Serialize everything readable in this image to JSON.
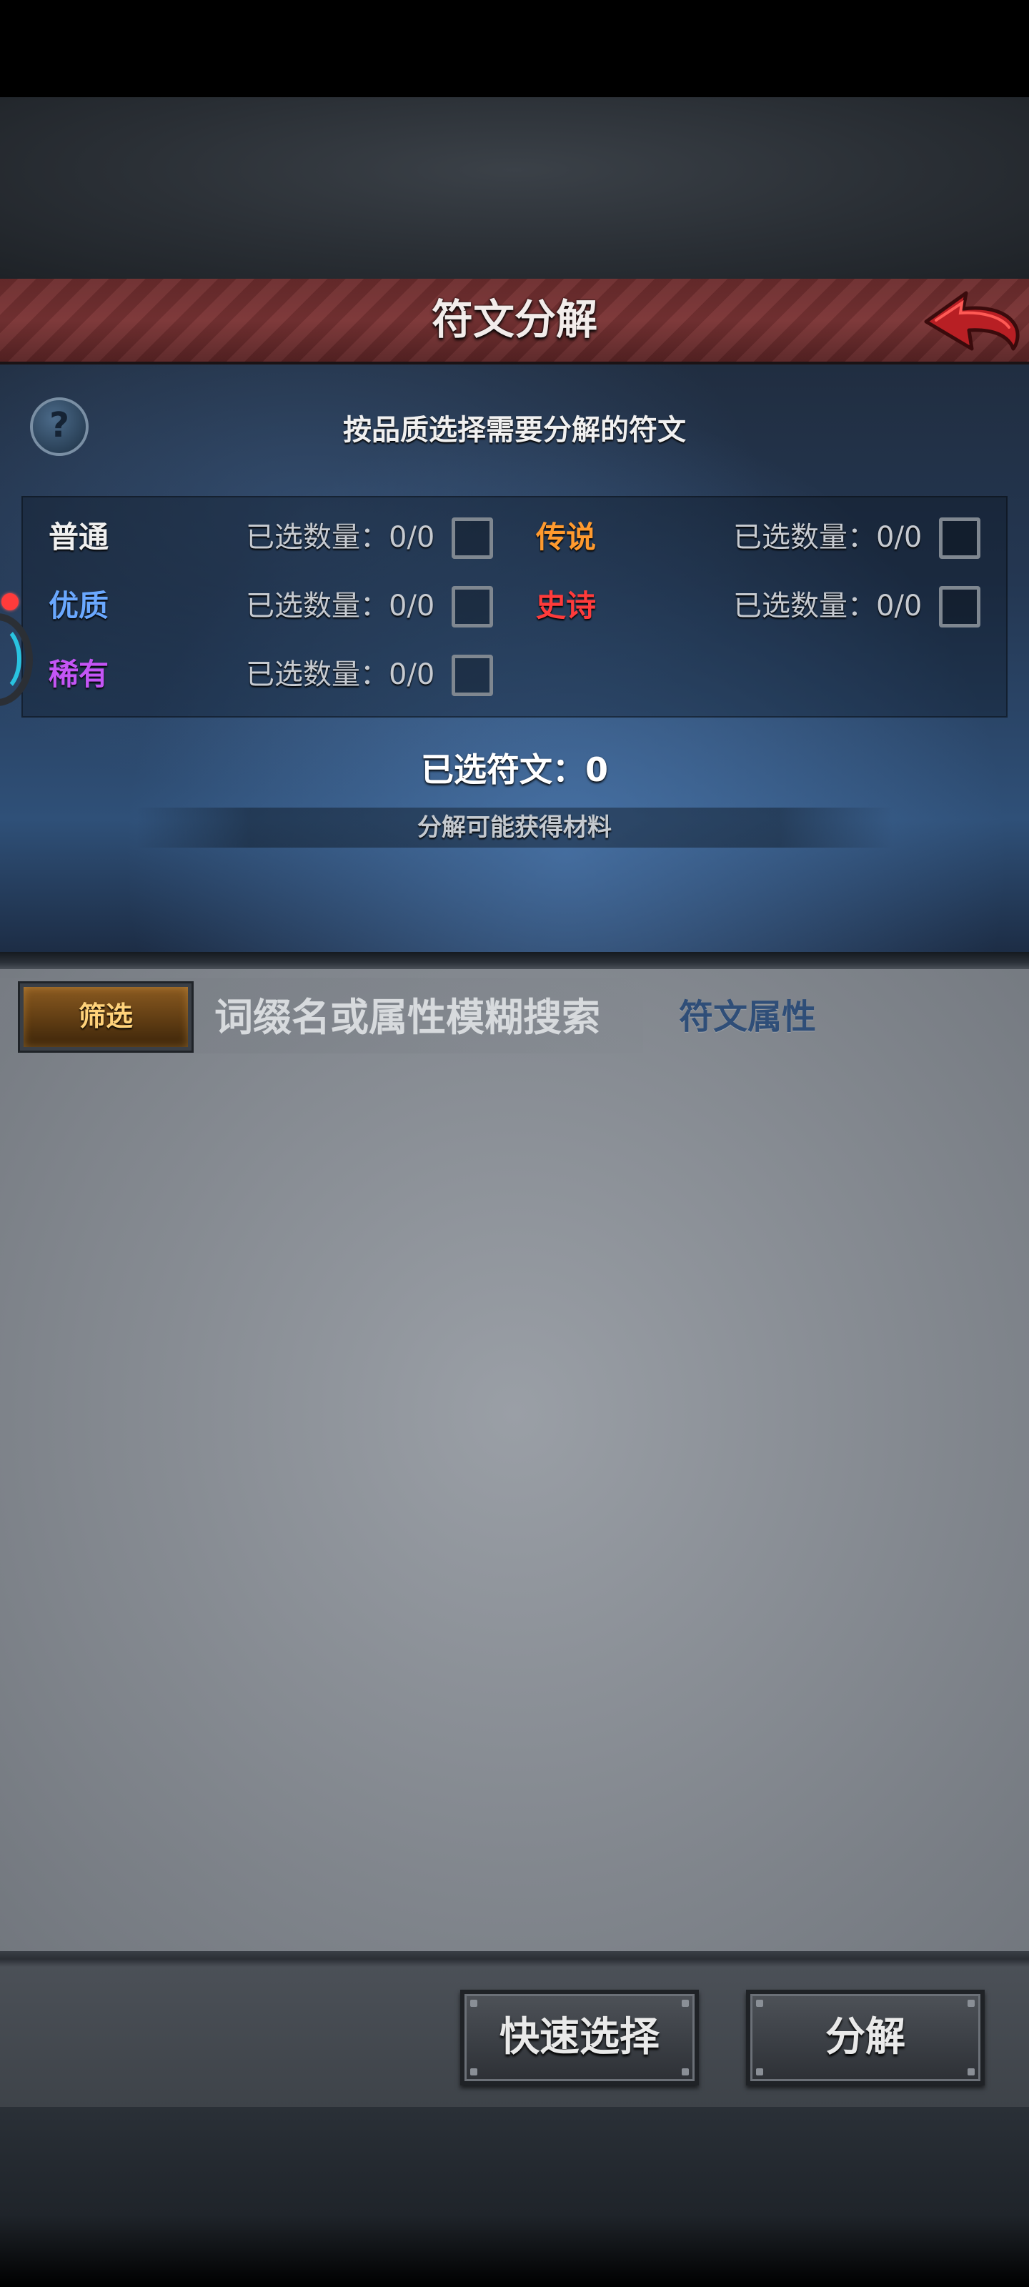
{
  "header": {
    "title": "符文分解"
  },
  "heading": {
    "text": "按品质选择需要分解的符文",
    "help_glyph": "?"
  },
  "qualities": {
    "left": [
      {
        "label": "普通",
        "count": "已选数量：0/0",
        "color": "#f0f0f0"
      },
      {
        "label": "优质",
        "count": "已选数量：0/0",
        "color": "#6aa8ff"
      },
      {
        "label": "稀有",
        "count": "已选数量：0/0",
        "color": "#c455f5"
      }
    ],
    "right": [
      {
        "label": "传说",
        "count": "已选数量：0/0",
        "color": "#ff9a2e"
      },
      {
        "label": "史诗",
        "count": "已选数量：0/0",
        "color": "#ff3b3b"
      }
    ]
  },
  "summary": {
    "selected_runes": "已选符文：0",
    "materials": "分解可能获得材料"
  },
  "filter": {
    "button_label": "筛选",
    "search_placeholder": "词缀名或属性模糊搜索",
    "attr_tab": "符文属性"
  },
  "actions": {
    "quick_select": "快速选择",
    "decompose": "分解"
  },
  "icons": {
    "back": "back-arrow-icon",
    "help": "question-icon"
  },
  "colors": {
    "title_bar": "#6d2d2e",
    "back_arrow": "#d8262b",
    "panel_blue": "#2f5078",
    "panel_grey": "#8a8f96"
  }
}
